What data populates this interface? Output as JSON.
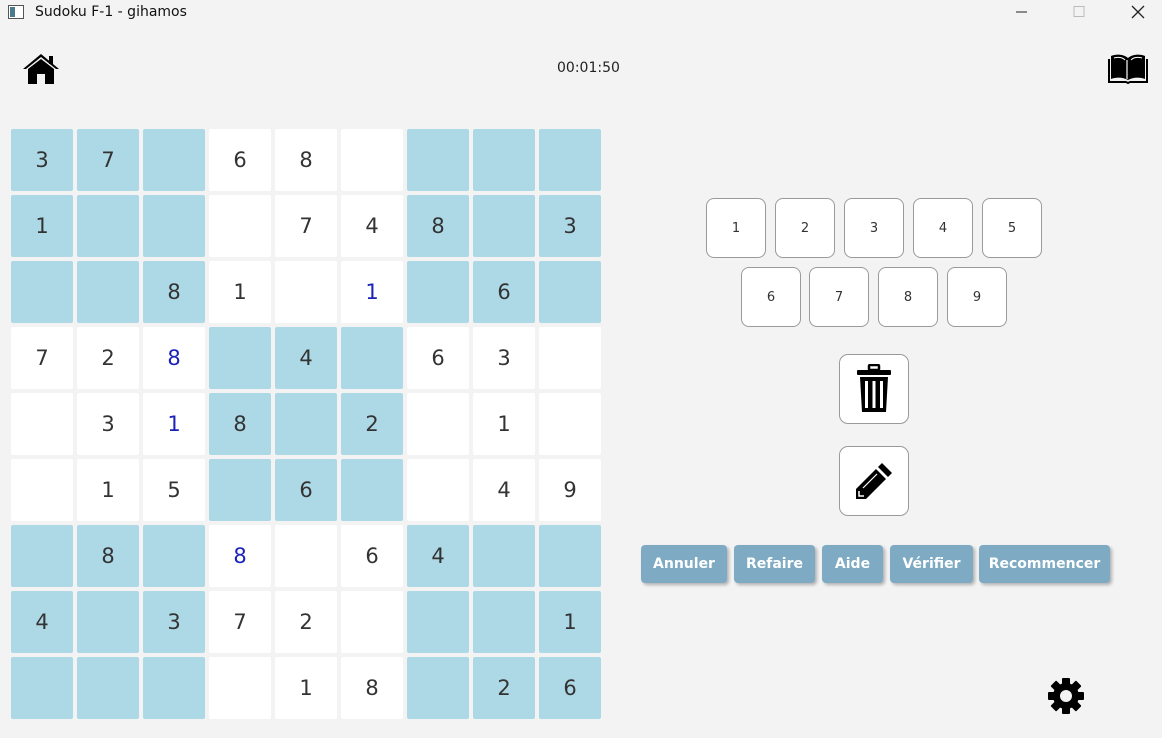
{
  "window": {
    "title": "Sudoku F-1 - gihamos"
  },
  "header": {
    "timer": "00:01:50",
    "home_icon": "home-icon",
    "book_icon": "book-icon"
  },
  "colors": {
    "shaded_cell": "#add8e6",
    "white_cell": "#ffffff",
    "user_digit": "#1a22b8",
    "action_button": "#7eabc3"
  },
  "board": {
    "values": [
      [
        "3",
        "7",
        "",
        "6",
        "8",
        "",
        "",
        "",
        ""
      ],
      [
        "1",
        "",
        "",
        "",
        "7",
        "4",
        "8",
        "",
        "3"
      ],
      [
        "",
        "",
        "8",
        "1",
        "",
        "1",
        "",
        "6",
        ""
      ],
      [
        "7",
        "2",
        "8",
        "",
        "4",
        "",
        "6",
        "3",
        ""
      ],
      [
        "",
        "3",
        "1",
        "8",
        "",
        "2",
        "",
        "1",
        ""
      ],
      [
        "",
        "1",
        "5",
        "",
        "6",
        "",
        "",
        "4",
        "9"
      ],
      [
        "",
        "8",
        "",
        "8",
        "",
        "6",
        "4",
        "",
        ""
      ],
      [
        "4",
        "",
        "3",
        "7",
        "2",
        "",
        "",
        "",
        "1"
      ],
      [
        "",
        "",
        "",
        "",
        "1",
        "8",
        "",
        "2",
        "6"
      ]
    ],
    "user_entered": [
      [
        2,
        5
      ],
      [
        3,
        2
      ],
      [
        4,
        2
      ],
      [
        6,
        3
      ]
    ]
  },
  "keypad": {
    "digits": [
      "1",
      "2",
      "3",
      "4",
      "5",
      "6",
      "7",
      "8",
      "9"
    ]
  },
  "tools": {
    "delete_icon": "trash-icon",
    "notes_icon": "pencil-icon"
  },
  "actions": {
    "undo": "Annuler",
    "redo": "Refaire",
    "help": "Aide",
    "check": "Vérifier",
    "restart": "Recommencer"
  },
  "settings": {
    "icon": "gear-icon"
  }
}
